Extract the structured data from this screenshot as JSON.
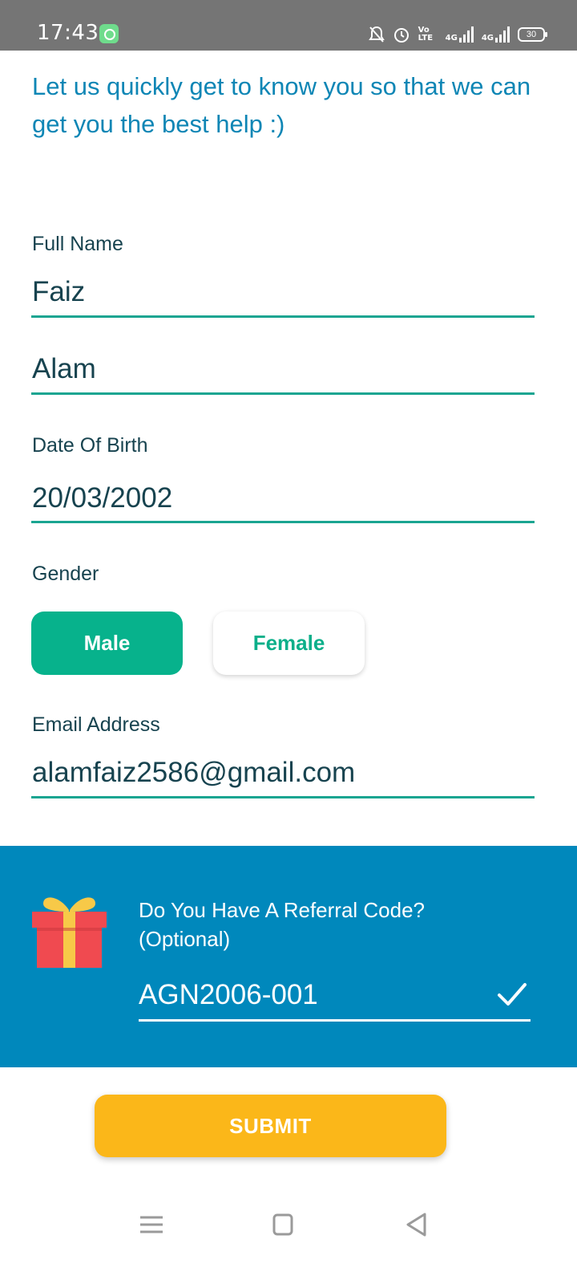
{
  "status_bar": {
    "time": "17:43",
    "icons": [
      "app-notification-icon",
      "mute-icon",
      "alarm-icon",
      "volte-icon",
      "signal-4g-icon",
      "signal-4g-icon",
      "battery-icon"
    ],
    "volte_label": "Vo LTE",
    "net1_label": "4G",
    "net2_label": "4G",
    "battery_level": "30"
  },
  "intro": {
    "text": "Let us quickly get to know you so that we can get you the best help :)"
  },
  "form": {
    "full_name_label": "Full Name",
    "first_name_value": "Faiz",
    "last_name_value": "Alam",
    "dob_label": "Date Of Birth",
    "dob_value": "20/03/2002",
    "gender_label": "Gender",
    "gender_options": [
      "Male",
      "Female"
    ],
    "gender_selected": "Male",
    "email_label": "Email Address",
    "email_value": "alamfaiz2586@gmail.com"
  },
  "referral": {
    "title_line1": "Do You Have A Referral Code?",
    "title_line2": "(Optional)",
    "code_value": "AGN2006-001",
    "icon": "gift-icon",
    "status_icon": "checkmark-icon"
  },
  "submit": {
    "label": "SUBMIT"
  },
  "navbar": {
    "items": [
      "menu-icon",
      "home-square-icon",
      "back-triangle-icon"
    ]
  },
  "colors": {
    "accent_teal": "#07b28c",
    "heading_blue": "#0e86b5",
    "referral_bg": "#0088bc",
    "submit_yellow": "#fbb719",
    "status_bar": "#757575"
  }
}
